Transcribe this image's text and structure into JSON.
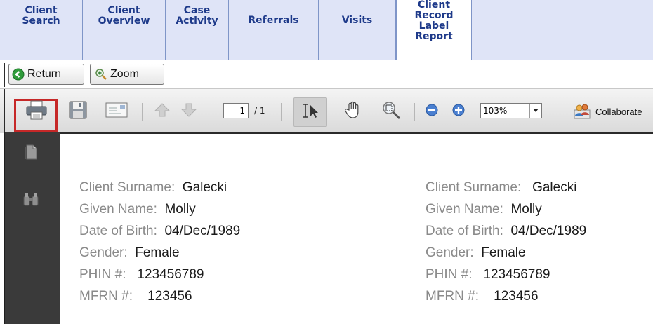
{
  "nav": {
    "tabs": [
      {
        "lines": [
          "Client",
          "Search"
        ]
      },
      {
        "lines": [
          "Client",
          "Overview"
        ]
      },
      {
        "lines": [
          "Case",
          "Activity"
        ]
      },
      {
        "lines": [
          "Referrals"
        ]
      },
      {
        "lines": [
          "Visits"
        ]
      },
      {
        "lines": [
          "Client",
          "Record",
          "Label",
          "Report"
        ]
      }
    ]
  },
  "buttons": {
    "return_label": "Return",
    "zoom_label": "Zoom"
  },
  "toolbar": {
    "page_current": "1",
    "page_total": "/ 1",
    "zoom_value": "103%",
    "collaborate_label": "Collaborate"
  },
  "labels": [
    {
      "surname_label": "Client Surname:",
      "surname": "Galecki",
      "given_label": "Given Name:",
      "given": "Molly",
      "dob_label": "Date of Birth:",
      "dob": "04/Dec/1989",
      "gender_label": "Gender:",
      "gender": "Female",
      "phin_label": "PHIN #:",
      "phin": "123456789",
      "mfrn_label": "MFRN #:",
      "mfrn": "123456"
    },
    {
      "surname_label": "Client Surname:",
      "surname": "Galecki",
      "given_label": "Given Name:",
      "given": "Molly",
      "dob_label": "Date of Birth:",
      "dob": "04/Dec/1989",
      "gender_label": "Gender:",
      "gender": "Female",
      "phin_label": "PHIN #:",
      "phin": "123456789",
      "mfrn_label": "MFRN #:",
      "mfrn": "123456"
    }
  ],
  "colors": {
    "tab_bg": "#dfe4f7",
    "tab_text": "#1e3a8a",
    "highlight": "#c62828"
  }
}
